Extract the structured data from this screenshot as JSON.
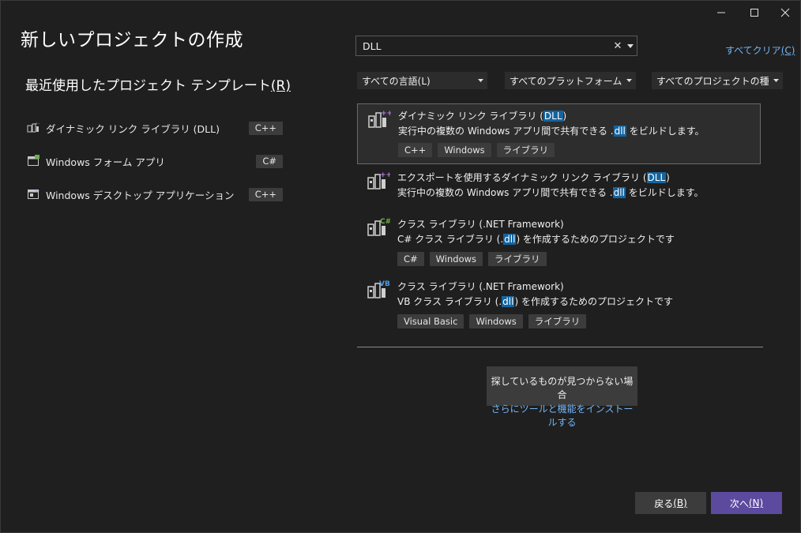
{
  "page": {
    "title": "新しいプロジェクトの作成",
    "recent_title": "最近使用したプロジェクト テンプレート",
    "recent_title_key": "(R)"
  },
  "recent": [
    {
      "label": "ダイナミック リンク ライブラリ (DLL)",
      "tag": "C++"
    },
    {
      "label": "Windows フォーム アプリ",
      "tag": "C#"
    },
    {
      "label": "Windows デスクトップ アプリケーション",
      "tag": "C++"
    }
  ],
  "search": {
    "value": "DLL",
    "clear_glyph": "✕",
    "clear_all_label": "すべてクリア",
    "clear_all_key": "(C)"
  },
  "filters": {
    "language": "すべての言語(L)",
    "platform": "すべてのプラットフォーム(P)",
    "type": "すべてのプロジェクトの種類(..."
  },
  "results": [
    {
      "title_pre": "ダイナミック リンク ライブラリ (",
      "title_hl": "DLL",
      "title_post": ")",
      "desc_pre": "実行中の複数の Windows アプリ間で共有できる .",
      "desc_hl": "dll",
      "desc_post": " をビルドします。",
      "tags": [
        "C++",
        "Windows",
        "ライブラリ"
      ],
      "icon_badge": "++"
    },
    {
      "title_pre": "エクスポートを使用するダイナミック リンク ライブラリ (",
      "title_hl": "DLL",
      "title_post": ")",
      "desc_pre": "実行中の複数の Windows アプリ間で共有できる .",
      "desc_hl": "dll",
      "desc_post": " をビルドします。",
      "tags": [],
      "icon_badge": "++"
    },
    {
      "title_pre": "クラス ライブラリ (.NET Framework)",
      "title_hl": "",
      "title_post": "",
      "desc_pre": "C# クラス ライブラリ (.",
      "desc_hl": "dll",
      "desc_post": ") を作成するためのプロジェクトです",
      "tags": [
        "C#",
        "Windows",
        "ライブラリ"
      ],
      "icon_badge": "C#"
    },
    {
      "title_pre": "クラス ライブラリ (.NET Framework)",
      "title_hl": "",
      "title_post": "",
      "desc_pre": "VB クラス ライブラリ (.",
      "desc_hl": "dll",
      "desc_post": ") を作成するためのプロジェクトです",
      "tags": [
        "Visual Basic",
        "Windows",
        "ライブラリ"
      ],
      "icon_badge": "VB"
    }
  ],
  "notfound": {
    "text": "探しているものが見つからない場合",
    "link": "さらにツールと機能をインストールする"
  },
  "buttons": {
    "back": "戻る",
    "back_key": "(B)",
    "next": "次へ",
    "next_key": "(N)"
  },
  "colors": {
    "background": "#1f1f1f",
    "accent": "#5b4a9e",
    "highlight": "#1464a0",
    "link": "#73b4f5"
  }
}
